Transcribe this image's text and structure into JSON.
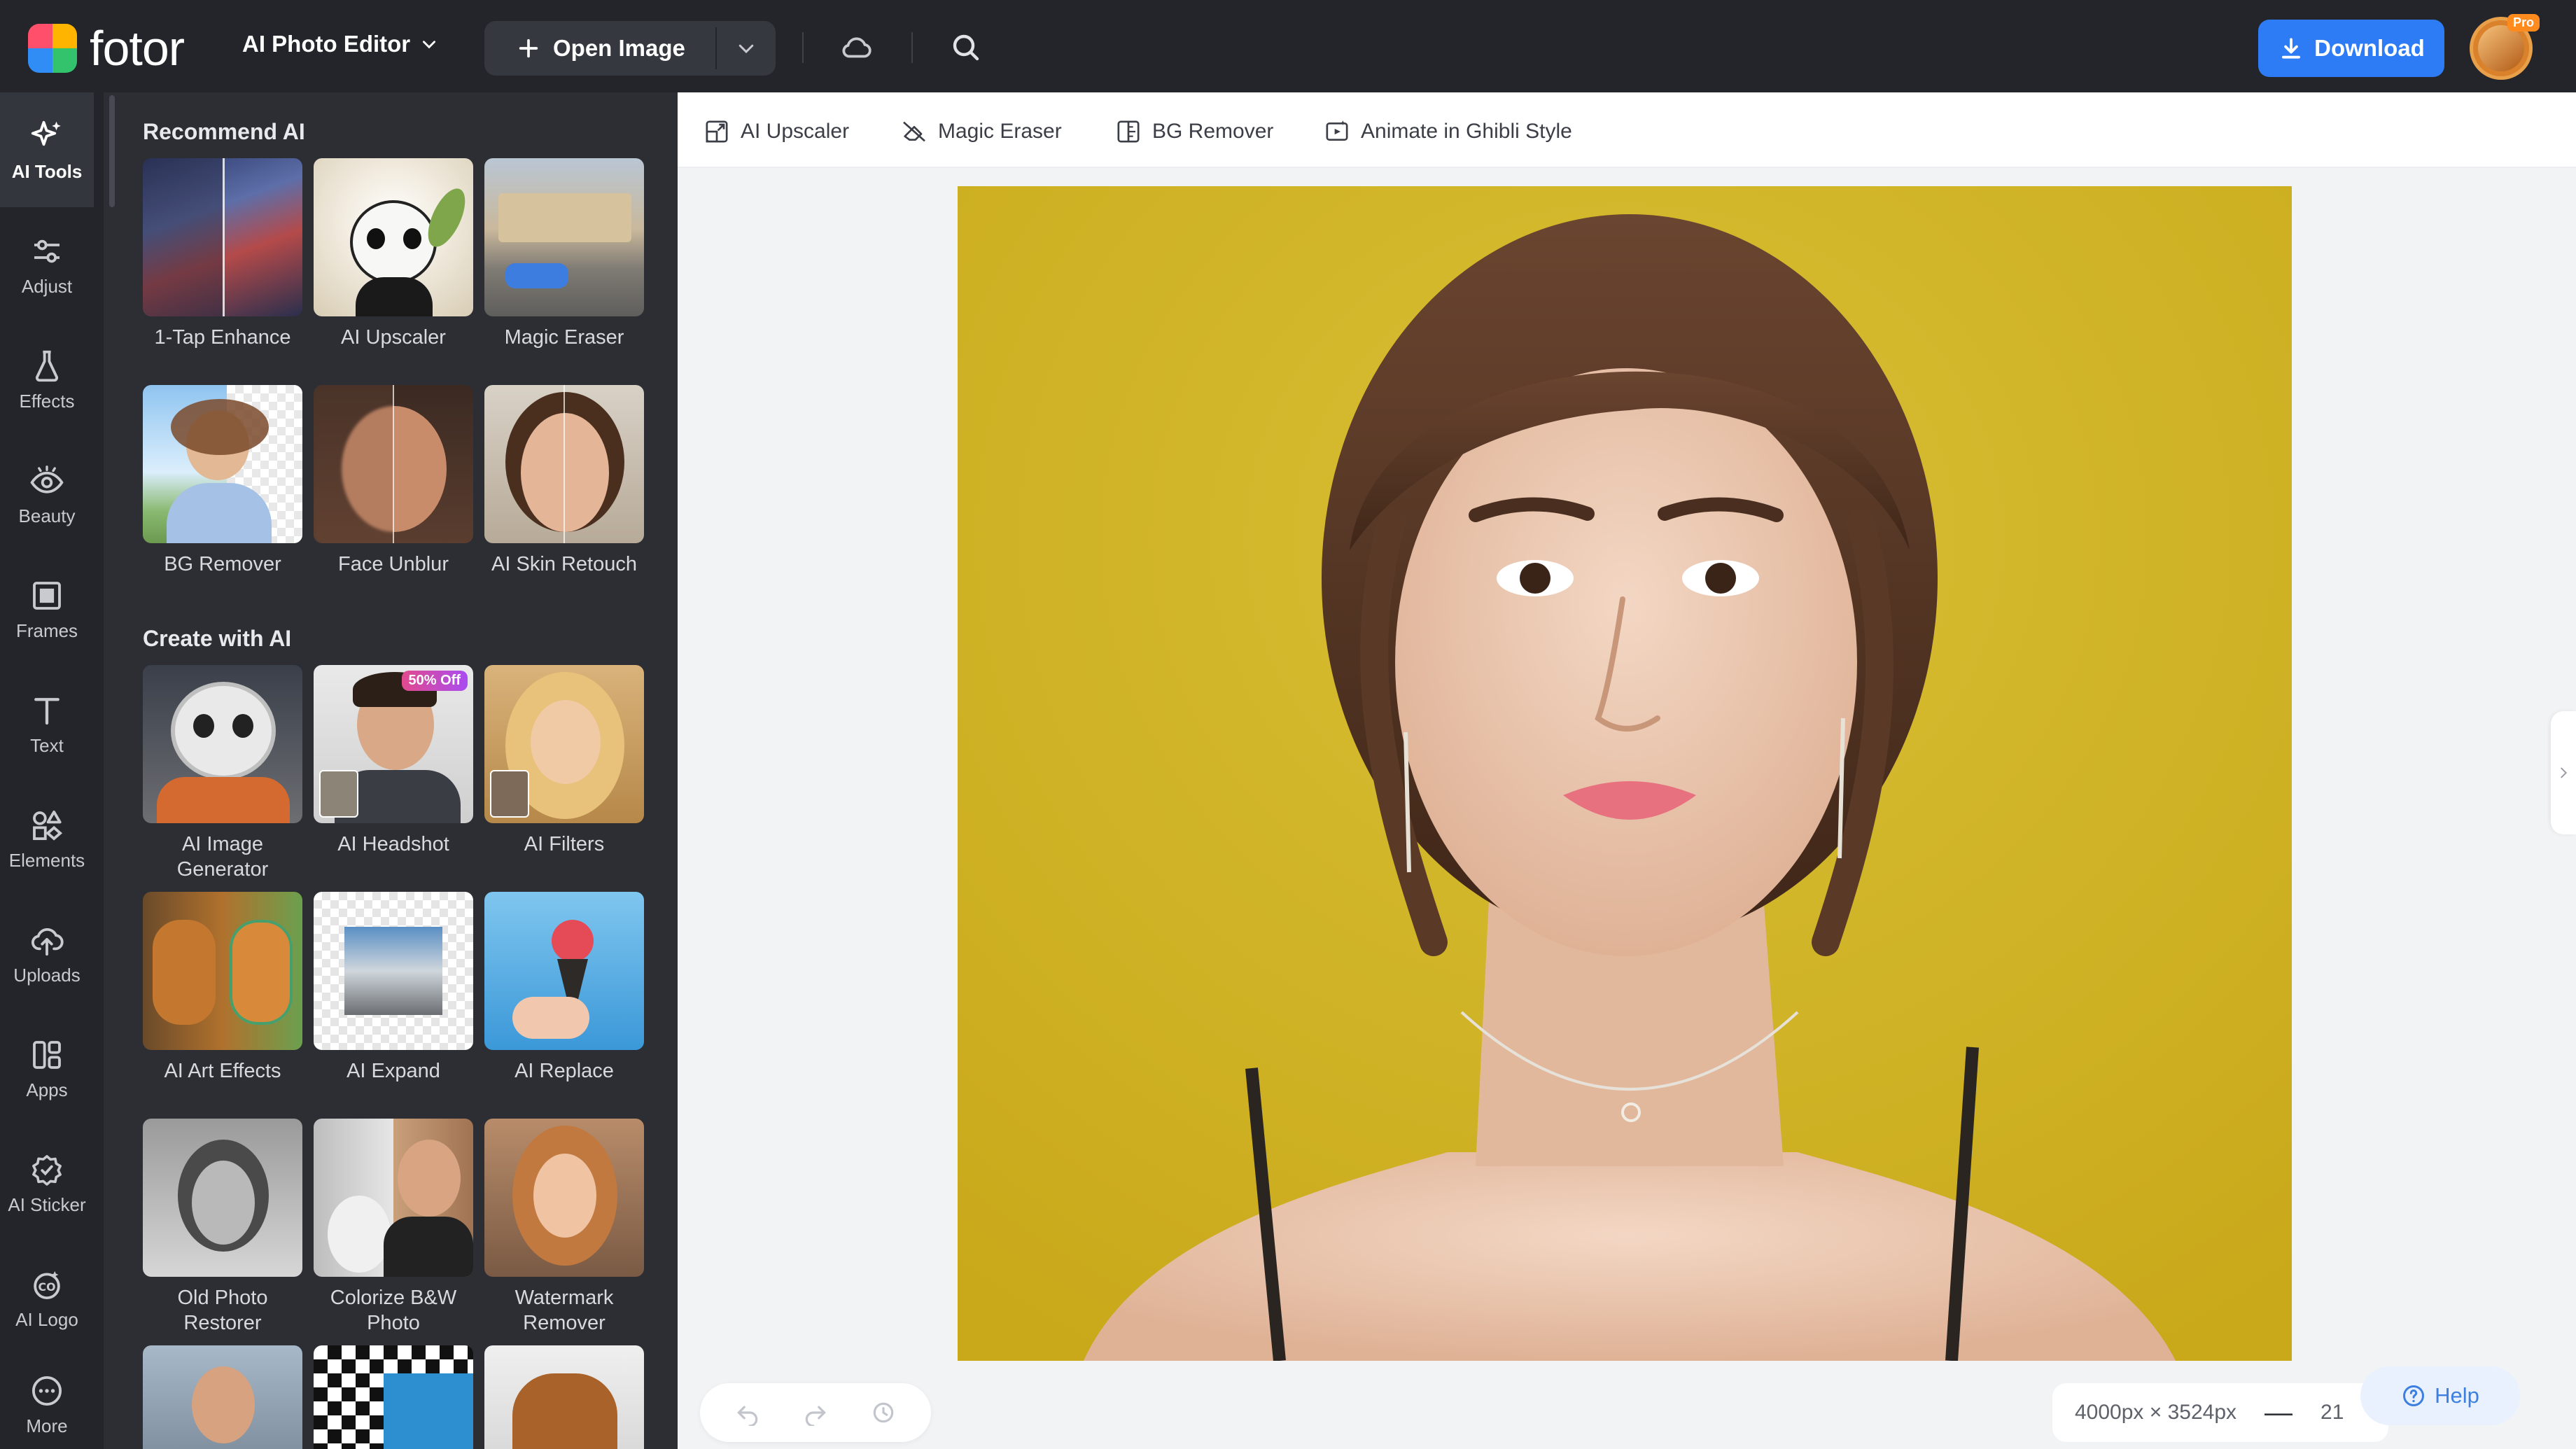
{
  "topbar": {
    "logo_text": "fotor",
    "editor_menu_label": "AI Photo Editor",
    "open_image_label": "Open Image",
    "download_label": "Download",
    "pro_badge": "Pro",
    "colors": {
      "bar": "#23252b",
      "download": "#2d7cf6"
    }
  },
  "rail": {
    "items": [
      {
        "label": "AI Tools",
        "icon": "sparkle-icon",
        "active": true
      },
      {
        "label": "Adjust",
        "icon": "sliders-icon"
      },
      {
        "label": "Effects",
        "icon": "flask-icon"
      },
      {
        "label": "Beauty",
        "icon": "eye-icon"
      },
      {
        "label": "Frames",
        "icon": "frame-icon"
      },
      {
        "label": "Text",
        "icon": "text-icon"
      },
      {
        "label": "Elements",
        "icon": "shapes-icon"
      },
      {
        "label": "Uploads",
        "icon": "upload-cloud-icon"
      },
      {
        "label": "Apps",
        "icon": "apps-icon"
      },
      {
        "label": "AI Sticker",
        "icon": "sticker-icon"
      },
      {
        "label": "AI Logo",
        "icon": "logo-icon"
      },
      {
        "label": "More",
        "icon": "more-icon"
      }
    ]
  },
  "panel": {
    "recommend_title": "Recommend AI",
    "create_title": "Create with AI",
    "recommend": [
      {
        "label": "1-Tap Enhance"
      },
      {
        "label": "AI Upscaler"
      },
      {
        "label": "Magic Eraser"
      },
      {
        "label": "BG Remover"
      },
      {
        "label": "Face Unblur"
      },
      {
        "label": "AI Skin Retouch"
      }
    ],
    "create": [
      {
        "label": "AI Image Generator"
      },
      {
        "label": "AI Headshot",
        "badge": "50% Off"
      },
      {
        "label": "AI Filters"
      },
      {
        "label": "AI Art Effects"
      },
      {
        "label": "AI Expand"
      },
      {
        "label": "AI Replace"
      },
      {
        "label": "Old Photo Restorer"
      },
      {
        "label": "Colorize B&W Photo"
      },
      {
        "label": "Watermark Remover"
      }
    ]
  },
  "toolstrip": {
    "items": [
      {
        "label": "AI Upscaler",
        "icon": "upscale-icon"
      },
      {
        "label": "Magic Eraser",
        "icon": "eraser-icon"
      },
      {
        "label": "BG Remover",
        "icon": "bg-remove-icon"
      },
      {
        "label": "Animate in Ghibli Style",
        "icon": "animate-icon"
      }
    ]
  },
  "canvas": {
    "dimensions": "4000px × 3524px",
    "zoom_partial": "21",
    "help_label": "Help",
    "photo_background": "#d3b523"
  }
}
